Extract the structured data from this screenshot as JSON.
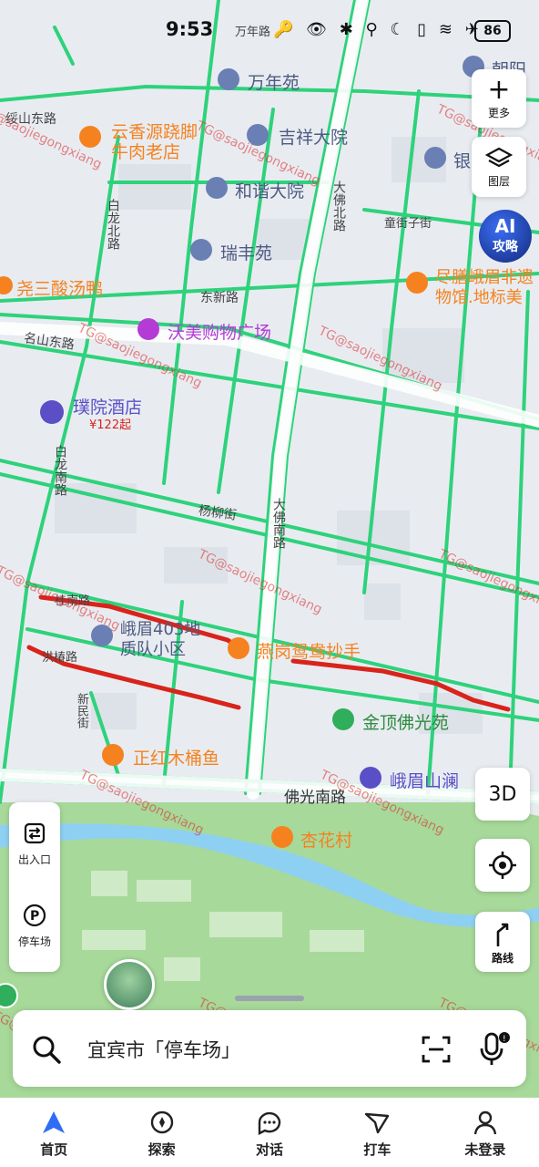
{
  "status_bar": {
    "time": "9:53",
    "icons": "🔑 👁 ✱ ⚲ ☾ ▯ ≋ ✈",
    "battery": "86"
  },
  "map": {
    "labels": [
      {
        "text": "万年路",
        "kind": "road"
      },
      {
        "text": "万年苑",
        "kind": "poi"
      },
      {
        "text": "朝阳小",
        "kind": "poi"
      },
      {
        "text": "绥山东路",
        "kind": "road"
      },
      {
        "text": "云香源跷脚",
        "kind": "food"
      },
      {
        "text": "牛肉老店",
        "kind": "food"
      },
      {
        "text": "吉祥大院",
        "kind": "poi"
      },
      {
        "text": "银",
        "kind": "poi"
      },
      {
        "text": "和谐大院",
        "kind": "poi"
      },
      {
        "text": "大佛北路",
        "kind": "road"
      },
      {
        "text": "白龙北路",
        "kind": "road"
      },
      {
        "text": "童街子街",
        "kind": "road"
      },
      {
        "text": "瑞丰苑",
        "kind": "poi"
      },
      {
        "text": "尧三酸汤鸭",
        "kind": "food"
      },
      {
        "text": "尽膳峨眉非遗",
        "kind": "food"
      },
      {
        "text": "物馆.地标美",
        "kind": "food"
      },
      {
        "text": "东新路",
        "kind": "road"
      },
      {
        "text": "沃美购物广场",
        "kind": "shop"
      },
      {
        "text": "名山东路",
        "kind": "road"
      },
      {
        "text": "璞院酒店",
        "kind": "hotel"
      },
      {
        "text": "¥122起",
        "kind": "price"
      },
      {
        "text": "白龙南路",
        "kind": "road"
      },
      {
        "text": "杨柳街",
        "kind": "road"
      },
      {
        "text": "大佛南路",
        "kind": "road"
      },
      {
        "text": "桂南路",
        "kind": "road"
      },
      {
        "text": "峨眉403地",
        "kind": "poi"
      },
      {
        "text": "质队小区",
        "kind": "poi"
      },
      {
        "text": "燕岗鸳鸯抄手",
        "kind": "food"
      },
      {
        "text": "洪椿路",
        "kind": "road"
      },
      {
        "text": "新民街",
        "kind": "road"
      },
      {
        "text": "金顶佛光苑",
        "kind": "park"
      },
      {
        "text": "正红木桶鱼",
        "kind": "food"
      },
      {
        "text": "佛光南路",
        "kind": "road"
      },
      {
        "text": "峨眉山澜",
        "kind": "hotel"
      },
      {
        "text": "杏花村",
        "kind": "food"
      }
    ],
    "watermark": "TG@saojiegongxiang",
    "colors": {
      "road_green": "#28c770",
      "food_orange": "#f5821f",
      "poi_blue": "#5b6fa6",
      "annotation_red": "#d8241b",
      "park_green": "#9bd48f",
      "shop_purple": "#b53bd6",
      "hotel_purple": "#5a4fc7"
    }
  },
  "right_controls": {
    "more_label": "更多",
    "layers_label": "图层",
    "ai_label_1": "AI",
    "ai_label_2": "攻略",
    "three_d_label": "3D",
    "route_label": "路线"
  },
  "left_controls": {
    "exits_label": "出入口",
    "parking_label": "停车场"
  },
  "search": {
    "text": "宜宾市「停车场」"
  },
  "bottom_nav": [
    {
      "label": "首页"
    },
    {
      "label": "探索"
    },
    {
      "label": "对话"
    },
    {
      "label": "打车"
    },
    {
      "label": "未登录"
    }
  ]
}
